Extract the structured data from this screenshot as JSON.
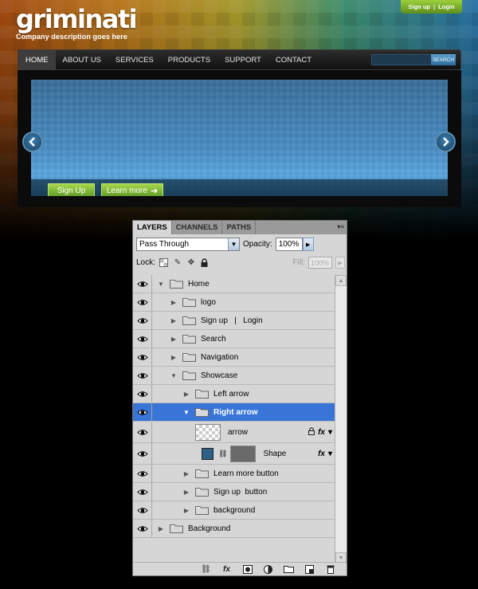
{
  "site": {
    "logo": "griminati",
    "tagline": "Company description goes here",
    "signup_link": "Sign up",
    "login_link": "Login",
    "link_separator": "|",
    "nav": [
      "HOME",
      "ABOUT US",
      "SERVICES",
      "PRODUCTS",
      "SUPPORT",
      "CONTACT"
    ],
    "nav_active": "HOME",
    "search_button": "SEARCH",
    "showcase_buttons": {
      "signup": "Sign Up",
      "learn_more": "Learn more"
    },
    "colors": {
      "accent_green": "#7fba32",
      "nav_bg": "#1e1e1e",
      "showcase_blue": "#4a8fc4"
    }
  },
  "panel": {
    "tabs": [
      "LAYERS",
      "CHANNELS",
      "PATHS"
    ],
    "active_tab": "LAYERS",
    "blend_mode": "Pass Through",
    "opacity_label": "Opacity:",
    "opacity_value": "100%",
    "lock_label": "Lock:",
    "fill_label": "Fill:",
    "fill_value": "100%",
    "layers": [
      {
        "name": "Home",
        "type": "group",
        "expanded": true,
        "indent": 0
      },
      {
        "name": "logo",
        "type": "group",
        "expanded": false,
        "indent": 1
      },
      {
        "name": "Sign up   |   Login",
        "type": "group",
        "expanded": false,
        "indent": 1
      },
      {
        "name": "Search",
        "type": "group",
        "expanded": false,
        "indent": 1
      },
      {
        "name": "Navigation",
        "type": "group",
        "expanded": false,
        "indent": 1
      },
      {
        "name": "Showcase",
        "type": "group",
        "expanded": true,
        "indent": 1
      },
      {
        "name": "Left arrow",
        "type": "group",
        "expanded": false,
        "indent": 2
      },
      {
        "name": "Right arrow",
        "type": "group",
        "expanded": true,
        "indent": 2,
        "selected": true
      },
      {
        "name": "arrow",
        "type": "layer",
        "indent": 3,
        "thumb": "transparent",
        "locked": true,
        "fx": true
      },
      {
        "name": "Shape",
        "type": "shape",
        "indent": 3,
        "swatch": "#2e6185",
        "fx": true
      },
      {
        "name": "Learn more button",
        "type": "group",
        "expanded": false,
        "indent": 2
      },
      {
        "name": "Sign up  button",
        "type": "group",
        "expanded": false,
        "indent": 2
      },
      {
        "name": "background",
        "type": "group",
        "expanded": false,
        "indent": 2
      },
      {
        "name": "Background",
        "type": "group",
        "expanded": false,
        "indent": 0
      }
    ],
    "footer_icons": [
      "link-icon",
      "fx-icon",
      "mask-icon",
      "adjustment-icon",
      "new-group-icon",
      "new-layer-icon",
      "trash-icon"
    ]
  }
}
